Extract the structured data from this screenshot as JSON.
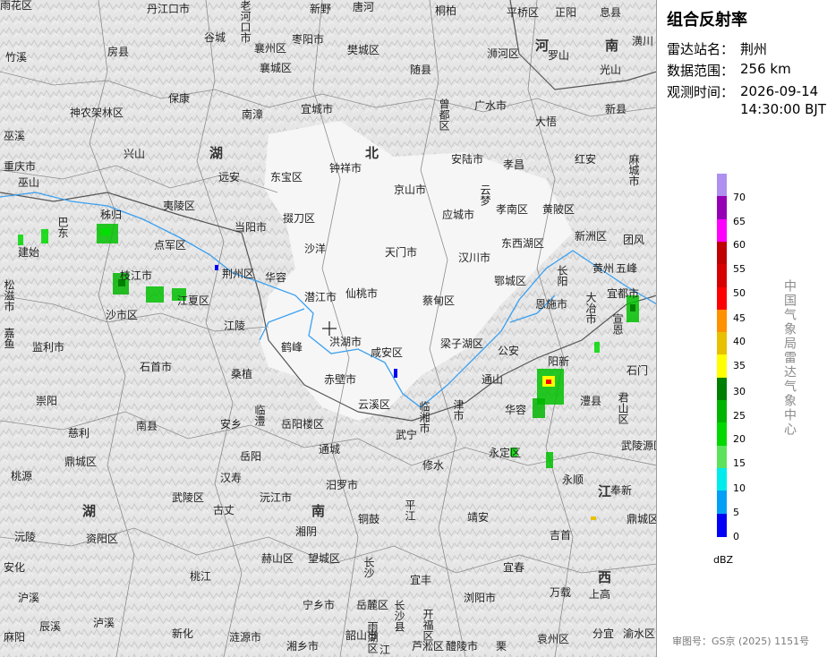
{
  "panel": {
    "title": "组合反射率",
    "station_label": "雷达站名：",
    "station_value": "荆州",
    "range_label": "数据范围：",
    "range_value": "256 km",
    "time_label": "观测时间：",
    "time_date": "2026-09-14",
    "time_clock": "14:30:00 BJT",
    "unit": "dBZ",
    "vertical_label": "中国气象局雷达气象中心",
    "approval": "审图号：GS京 (2025) 1151号"
  },
  "legend": {
    "ticks": [
      "70",
      "65",
      "60",
      "55",
      "50",
      "45",
      "40",
      "35",
      "30",
      "25",
      "20",
      "15",
      "10",
      "5",
      "0"
    ],
    "colors": [
      "#ad90f0",
      "#9600b4",
      "#ff00ff",
      "#c00000",
      "#d60000",
      "#ff0000",
      "#ff9000",
      "#e7c000",
      "#ffff00",
      "#008000",
      "#00b400",
      "#00d800",
      "#5ee25e",
      "#00ecec",
      "#01a0f6",
      "#0000f6"
    ]
  },
  "colors": {
    "map_bg": "#e9e9e9",
    "river": "#3aa0f0",
    "boundary": "#8c8c8c",
    "province_boundary": "#555555"
  },
  "province_labels": [
    "湖",
    "北",
    "河",
    "南",
    "湖",
    "南",
    "江",
    "西"
  ],
  "cities": [
    "丹江口市",
    "老河口市",
    "新野",
    "唐河",
    "桐柏",
    "平桥区",
    "正阳",
    "息县",
    "谷城",
    "襄州区",
    "枣阳市",
    "樊城区",
    "襄城区",
    "浉河区",
    "罗山",
    "光山",
    "潢川",
    "竹溪",
    "房县",
    "随县",
    "保康",
    "南漳",
    "宜城市",
    "曾都区",
    "广水市",
    "神农架林区",
    "大悟",
    "新县",
    "巫溪",
    "兴山",
    "钟祥市",
    "安陆市",
    "孝昌",
    "红安",
    "麻城市",
    "重庆市",
    "巫山",
    "远安",
    "东宝区",
    "京山市",
    "云梦",
    "孝南区",
    "黄陂区",
    "秭归",
    "掇刀区",
    "应城市",
    "巴东",
    "夷陵区",
    "当阳市",
    "沙洋",
    "新洲区",
    "团风",
    "建始",
    "点军区",
    "天门市",
    "汉川市",
    "东西湖区",
    "长阳",
    "枝江市",
    "荆州区",
    "华容",
    "黄州",
    "五峰",
    "沙市区",
    "潜江市",
    "仙桃市",
    "蔡甸区",
    "鄂城区",
    "宜都市",
    "江夏区",
    "恩施市",
    "松滋市",
    "江陵",
    "洪湖市",
    "梁子湖区",
    "大冶市",
    "宣恩",
    "嘉鱼",
    "公安",
    "鹤峰",
    "监利市",
    "咸安区",
    "阳新",
    "石门",
    "石首市",
    "赤壁市",
    "通山",
    "澧县",
    "桑植",
    "崇阳",
    "华容",
    "君山区",
    "云溪区",
    "临湘市",
    "津市",
    "临澧",
    "安乡",
    "岳阳楼区",
    "武宁",
    "武陵源区",
    "慈利",
    "南县",
    "通城",
    "永定区",
    "鼎城区",
    "岳阳",
    "修水",
    "永顺",
    "桃源",
    "武陵区",
    "汉寿",
    "沅江市",
    "汨罗市",
    "平江",
    "靖安",
    "奉新",
    "鼎城区",
    "古丈",
    "沅陵",
    "资阳区",
    "湘阴",
    "铜鼓",
    "吉首",
    "安化",
    "桃江",
    "赫山区",
    "望城区",
    "长沙",
    "宜丰",
    "宜春",
    "沪溪",
    "长沙县",
    "上高",
    "万载",
    "泸溪",
    "辰溪",
    "宁乡市",
    "岳麓区",
    "浏阳市",
    "分宜",
    "渝水区",
    "麻阳",
    "新化",
    "涟源市",
    "湘乡市",
    "韶山市",
    "雨湖区",
    "芦淞区",
    "醴陵市",
    "栗",
    "袁州区",
    "江",
    "开福区",
    "雨花区"
  ]
}
